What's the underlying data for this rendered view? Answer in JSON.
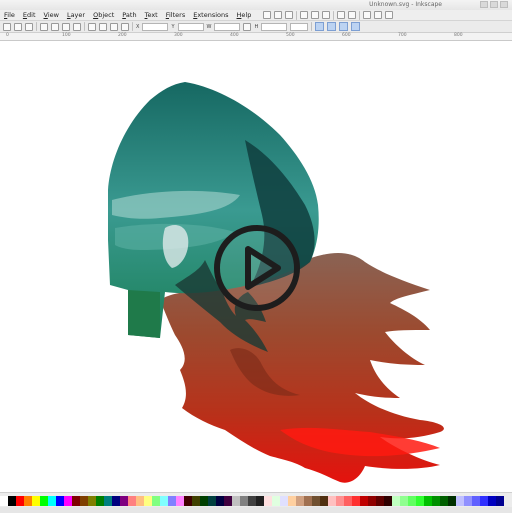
{
  "window": {
    "title": "Unknown.svg - Inkscape"
  },
  "menu": [
    {
      "label": "File"
    },
    {
      "label": "Edit"
    },
    {
      "label": "View"
    },
    {
      "label": "Layer"
    },
    {
      "label": "Object"
    },
    {
      "label": "Path"
    },
    {
      "label": "Text"
    },
    {
      "label": "Filters"
    },
    {
      "label": "Extensions"
    },
    {
      "label": "Help"
    }
  ],
  "toolbar": {
    "fields": [
      {
        "label": "X",
        "value": ""
      },
      {
        "label": "Y",
        "value": ""
      },
      {
        "label": "W",
        "value": ""
      },
      {
        "label": "H",
        "value": ""
      }
    ]
  },
  "ruler": {
    "ticks": [
      "0",
      "100",
      "200",
      "300",
      "400",
      "500",
      "600",
      "700",
      "800"
    ]
  },
  "artwork": {
    "description_colors": {
      "helmet_top": "#1f6a66",
      "helmet_mid": "#2f8b86",
      "helmet_bottom": "#1c7a57",
      "hair_top": "#8d5a46",
      "hair_mid": "#a43a1f",
      "hair_bottom": "#e0130d"
    }
  },
  "video": {
    "play_icon": "play-icon"
  },
  "palette": {
    "colors": [
      "#ffffff",
      "#000000",
      "#ff0000",
      "#ff7f00",
      "#ffff00",
      "#00ff00",
      "#00ffff",
      "#0000ff",
      "#ff00ff",
      "#7f0000",
      "#7f3f00",
      "#7f7f00",
      "#007f00",
      "#007f7f",
      "#00007f",
      "#7f007f",
      "#ff8080",
      "#ffbf80",
      "#ffff80",
      "#80ff80",
      "#80ffff",
      "#8080ff",
      "#ff80ff",
      "#400000",
      "#404000",
      "#004000",
      "#004040",
      "#000040",
      "#400040",
      "#c0c0c0",
      "#808080",
      "#404040",
      "#202020",
      "#ffe0e0",
      "#e0ffe0",
      "#e0e0ff",
      "#ffd0a0",
      "#d0a080",
      "#a07050",
      "#705030",
      "#503010",
      "#ffc0c0",
      "#ff9090",
      "#ff6060",
      "#ff3030",
      "#c00000",
      "#900000",
      "#600000",
      "#300000",
      "#c0ffc0",
      "#90ff90",
      "#60ff60",
      "#30ff30",
      "#00c000",
      "#009000",
      "#006000",
      "#003000",
      "#c0c0ff",
      "#9090ff",
      "#6060ff",
      "#3030ff",
      "#0000c0",
      "#000090"
    ]
  }
}
